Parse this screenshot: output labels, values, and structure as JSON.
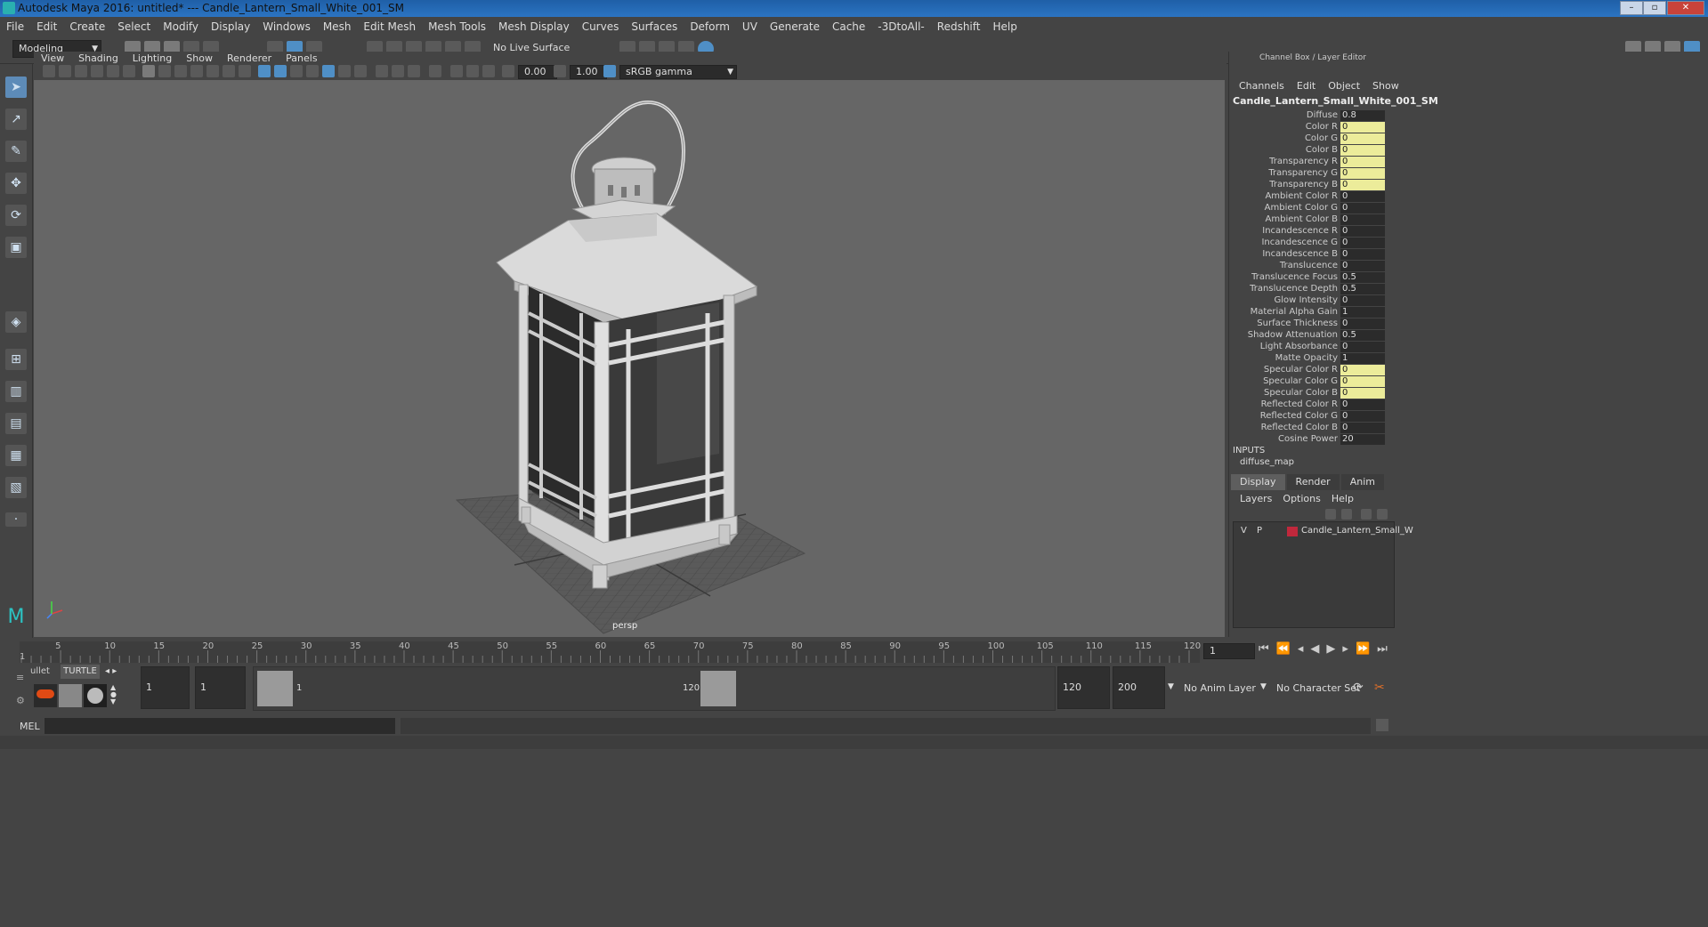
{
  "window": {
    "title": "Autodesk Maya 2016: untitled*   ---   Candle_Lantern_Small_White_001_SM",
    "min": "–",
    "max": "▫",
    "close": "✕"
  },
  "menus": [
    "File",
    "Edit",
    "Create",
    "Select",
    "Modify",
    "Display",
    "Windows",
    "Mesh",
    "Edit Mesh",
    "Mesh Tools",
    "Mesh Display",
    "Curves",
    "Surfaces",
    "Deform",
    "UV",
    "Generate",
    "Cache",
    "-3DtoAll-",
    "Redshift",
    "Help"
  ],
  "status": {
    "mode": "Modeling",
    "live_surface": "No Live Surface"
  },
  "viewport": {
    "menus": [
      "View",
      "Shading",
      "Lighting",
      "Show",
      "Renderer",
      "Panels"
    ],
    "exposure": "0.00",
    "gamma": "1.00",
    "color_space": "sRGB gamma",
    "camera": "persp"
  },
  "channel_box": {
    "header": "Channel Box / Layer Editor",
    "menus": [
      "Channels",
      "Edit",
      "Object",
      "Show"
    ],
    "object": "Candle_Lantern_Small_White_001_SM",
    "attributes": [
      {
        "label": "Diffuse",
        "value": "0.8",
        "keyed": false
      },
      {
        "label": "Color R",
        "value": "0",
        "keyed": true
      },
      {
        "label": "Color G",
        "value": "0",
        "keyed": true
      },
      {
        "label": "Color B",
        "value": "0",
        "keyed": true
      },
      {
        "label": "Transparency R",
        "value": "0",
        "keyed": true
      },
      {
        "label": "Transparency G",
        "value": "0",
        "keyed": true
      },
      {
        "label": "Transparency B",
        "value": "0",
        "keyed": true
      },
      {
        "label": "Ambient Color R",
        "value": "0",
        "keyed": false
      },
      {
        "label": "Ambient Color G",
        "value": "0",
        "keyed": false
      },
      {
        "label": "Ambient Color B",
        "value": "0",
        "keyed": false
      },
      {
        "label": "Incandescence R",
        "value": "0",
        "keyed": false
      },
      {
        "label": "Incandescence G",
        "value": "0",
        "keyed": false
      },
      {
        "label": "Incandescence B",
        "value": "0",
        "keyed": false
      },
      {
        "label": "Translucence",
        "value": "0",
        "keyed": false
      },
      {
        "label": "Translucence Focus",
        "value": "0.5",
        "keyed": false
      },
      {
        "label": "Translucence Depth",
        "value": "0.5",
        "keyed": false
      },
      {
        "label": "Glow Intensity",
        "value": "0",
        "keyed": false
      },
      {
        "label": "Material Alpha Gain",
        "value": "1",
        "keyed": false
      },
      {
        "label": "Surface Thickness",
        "value": "0",
        "keyed": false
      },
      {
        "label": "Shadow Attenuation",
        "value": "0.5",
        "keyed": false
      },
      {
        "label": "Light Absorbance",
        "value": "0",
        "keyed": false
      },
      {
        "label": "Matte Opacity",
        "value": "1",
        "keyed": false
      },
      {
        "label": "Specular Color R",
        "value": "0",
        "keyed": true
      },
      {
        "label": "Specular Color G",
        "value": "0",
        "keyed": true
      },
      {
        "label": "Specular Color B",
        "value": "0",
        "keyed": true
      },
      {
        "label": "Reflected Color R",
        "value": "0",
        "keyed": false
      },
      {
        "label": "Reflected Color G",
        "value": "0",
        "keyed": false
      },
      {
        "label": "Reflected Color B",
        "value": "0",
        "keyed": false
      },
      {
        "label": "Cosine Power",
        "value": "20",
        "keyed": false
      }
    ],
    "inputs_label": "INPUTS",
    "inputs_node": "diffuse_map"
  },
  "layer_editor": {
    "tabs": [
      "Display",
      "Render",
      "Anim"
    ],
    "menus": [
      "Layers",
      "Options",
      "Help"
    ],
    "layer": {
      "v": "V",
      "p": "P",
      "name": "Candle_Lantern_Small_W",
      "color": "#c0283c"
    }
  },
  "timeline": {
    "ticks": [
      "5",
      "10",
      "15",
      "20",
      "25",
      "30",
      "35",
      "40",
      "45",
      "50",
      "55",
      "60",
      "65",
      "70",
      "75",
      "80",
      "85",
      "90",
      "95",
      "100",
      "105",
      "110",
      "115",
      "120"
    ],
    "start_marker": "1",
    "current_frame": "1"
  },
  "range": {
    "shelf_tabs": [
      "ullet",
      "TURTLE"
    ],
    "start": "1",
    "playback_start": "1",
    "slider_start": "1",
    "slider_end": "120",
    "playback_end": "120",
    "end": "200",
    "anim_layer": "No Anim Layer",
    "character_set": "No Character Set"
  },
  "command": {
    "label": "MEL"
  }
}
